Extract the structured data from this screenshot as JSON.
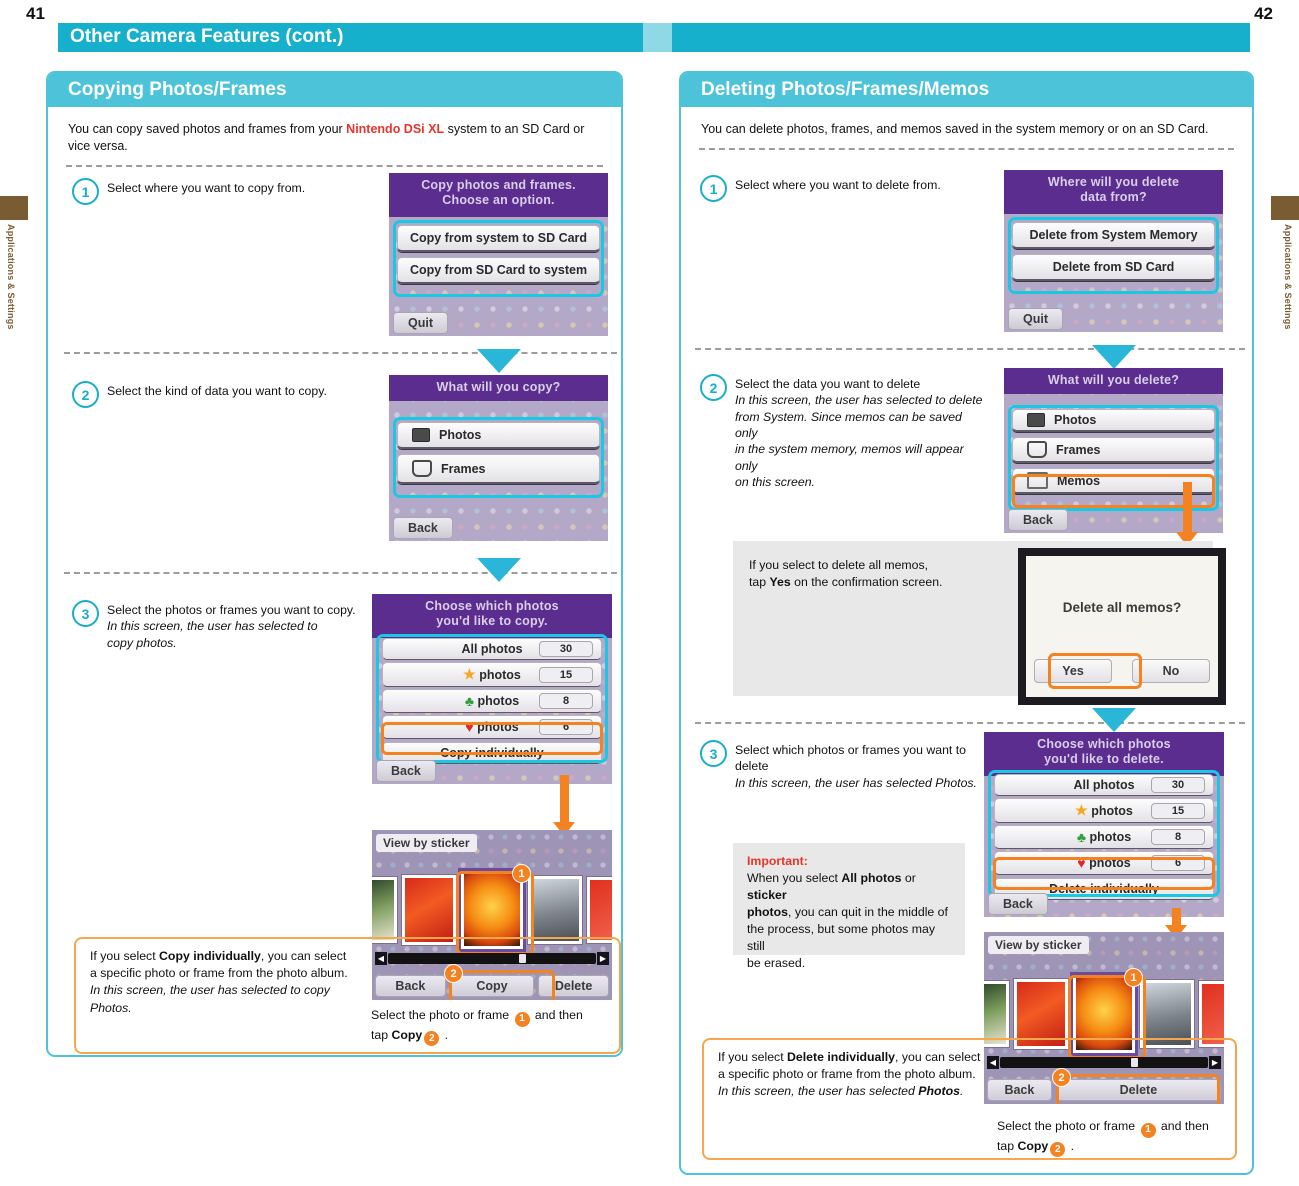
{
  "pages": {
    "left": "41",
    "right": "42"
  },
  "side_tab_label": "Applications & Settings",
  "chapter_title": "Other Camera Features (cont.)",
  "colors": {
    "cyan": "#17b0cc",
    "panel_border": "#4cc3d9",
    "orange": "#f58220",
    "red": "#e8352b",
    "brown": "#7a5c32",
    "ds_purple": "#5b2d8e"
  },
  "left_section": {
    "heading": "Copying Photos/Frames",
    "intro_pre": "You can copy saved photos and frames from your ",
    "intro_red": "Nintendo DSi XL",
    "intro_post": " system to an SD Card or vice versa.",
    "steps": [
      {
        "num": "1",
        "lines": [
          "Select where you want to copy from."
        ]
      },
      {
        "num": "2",
        "lines": [
          "Select the kind of data you want to copy."
        ]
      },
      {
        "num": "3",
        "lines": [
          "Select the photos or frames you want to copy.",
          "In this screen, the user has selected to",
          "copy photos."
        ]
      }
    ],
    "screen1": {
      "title_line1": "Copy photos and frames.",
      "title_line2": "Choose an option.",
      "buttons": [
        "Copy from system to SD Card",
        "Copy from SD Card to system"
      ],
      "foot": "Quit"
    },
    "screen2": {
      "title": "What will you copy?",
      "buttons": [
        "Photos",
        "Frames"
      ],
      "icons": [
        "photo-icon",
        "frame-icon"
      ],
      "foot": "Back"
    },
    "screen3": {
      "title_line1": "Choose which photos",
      "title_line2": "you'd like to copy.",
      "rows": [
        {
          "label": "All photos",
          "symbol": "",
          "count": "30"
        },
        {
          "label": "photos",
          "symbol": "★",
          "count": "15"
        },
        {
          "label": "photos",
          "symbol": "♣",
          "count": "8"
        },
        {
          "label": "photos",
          "symbol": "♥",
          "count": "6"
        }
      ],
      "individual": "Copy individually",
      "foot": "Back"
    },
    "album": {
      "tag": "View by sticker",
      "badge1": "1",
      "badge2": "2",
      "buttons": [
        "Back",
        "Copy",
        "Delete"
      ]
    },
    "note": {
      "line1_pre": "If you select ",
      "line1_bold": "Copy individually",
      "line1_post": ", you can select",
      "line2": "a specific photo or frame from the photo album.",
      "line3_italic": "In this screen, the user has selected to copy Photos."
    },
    "caption": {
      "pre": "Select the photo or frame ",
      "badge1": "1",
      "mid": " and then",
      "tap": "tap ",
      "bold": "Copy",
      "badge2": "2",
      "post": " ."
    }
  },
  "right_section": {
    "heading": "Deleting Photos/Frames/Memos",
    "intro": "You can delete photos, frames, and memos saved in the system memory or on an SD Card.",
    "steps": [
      {
        "num": "1",
        "lines": [
          "Select where you want to delete from."
        ]
      },
      {
        "num": "2",
        "lines": [
          "Select the data you want to delete",
          "In this screen, the user has selected to delete",
          "from System. Since memos can be saved only",
          "in the system memory, memos will appear only",
          "on this screen."
        ]
      },
      {
        "num": "3",
        "lines": [
          "Select which photos or frames you want to delete",
          "In this screen, the user has selected Photos."
        ]
      }
    ],
    "screen1": {
      "title_line1": "Where will you delete",
      "title_line2": "data from?",
      "buttons": [
        "Delete from System Memory",
        "Delete from SD Card"
      ],
      "foot": "Quit"
    },
    "screen2": {
      "title": "What will you delete?",
      "buttons": [
        "Photos",
        "Frames",
        "Memos"
      ],
      "icons": [
        "photo-icon",
        "frame-icon",
        "memo-icon"
      ],
      "foot": "Back"
    },
    "memo_note": {
      "line1": "If you select to delete all memos,",
      "line2_pre": "tap ",
      "line2_bold": "Yes",
      "line2_post": " on the confirmation screen."
    },
    "confirm": {
      "message": "Delete all memos?",
      "yes": "Yes",
      "no": "No"
    },
    "screen3": {
      "title_line1": "Choose which photos",
      "title_line2": "you'd like to delete.",
      "rows": [
        {
          "label": "All photos",
          "symbol": "",
          "count": "30"
        },
        {
          "label": "photos",
          "symbol": "★",
          "count": "15"
        },
        {
          "label": "photos",
          "symbol": "♣",
          "count": "8"
        },
        {
          "label": "photos",
          "symbol": "♥",
          "count": "6"
        }
      ],
      "individual": "Delete individually",
      "foot": "Back"
    },
    "important": {
      "label": "Important:",
      "line1_pre": "When you select ",
      "line1_b1": "All photos",
      "line1_mid": " or ",
      "line1_b2": "sticker",
      "line2_b": "photos",
      "line2_post": ", you can quit in the middle of",
      "line3": "the process, but some photos may still",
      "line4": " be erased."
    },
    "album": {
      "tag": "View by sticker",
      "badge1": "1",
      "badge2": "2",
      "buttons": [
        "Back",
        "Delete"
      ]
    },
    "note": {
      "line1_pre": "If you select ",
      "line1_bold": "Delete individually",
      "line1_post": ", you can select",
      "line2": "a specific photo or frame from the photo album.",
      "line3_italic_pre": "In this screen, the user has selected ",
      "line3_italic_bold": "Photos",
      "line3_italic_post": "."
    },
    "caption": {
      "pre": "Select the photo or frame ",
      "badge1": "1",
      "mid": " and then",
      "tap": "tap ",
      "bold": "Copy",
      "badge2": "2",
      "post": " ."
    }
  }
}
